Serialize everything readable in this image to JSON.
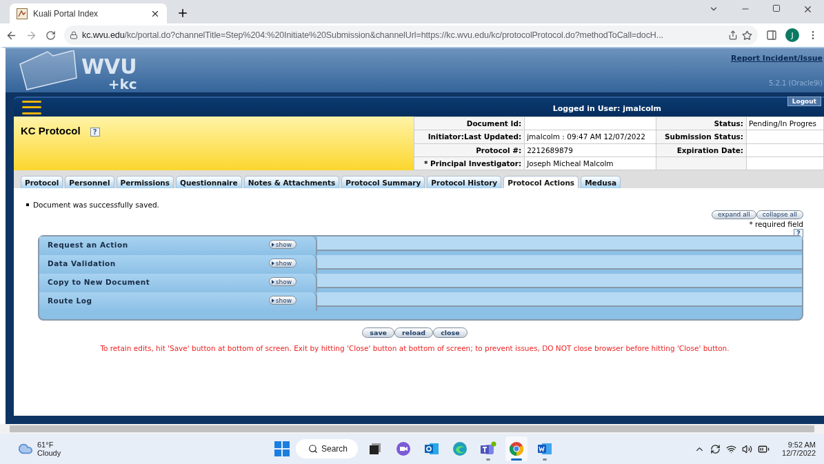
{
  "browser": {
    "tab_title": "Kuali Portal Index",
    "url_host": "kc.wvu.edu",
    "url_path": "/kc/portal.do?channelTitle=Step%204:%20Initiate%20Submission&channelUrl=https://kc.wvu.edu/kc/protocolProtocol.do?methodToCall=docH...",
    "avatar_letter": "J"
  },
  "header": {
    "logo_main": "WVU",
    "logo_sub": "+kc",
    "report_link": "Report Incident/Issue",
    "version": "5.2.1 (Oracle9i)"
  },
  "nav": {
    "logged_in": "Logged in User: jmalcolm",
    "logout": "Logout"
  },
  "document": {
    "title": "KC Protocol",
    "help": "?",
    "info": [
      {
        "label": "Document Id:",
        "label2": "Status:",
        "value2": "Pending/In Progres"
      },
      {
        "label": "Initiator:Last Updated:",
        "value": "jmalcolm : 09:47 AM 12/07/2022",
        "label2": "Submission Status:"
      },
      {
        "label": "Protocol #:",
        "value": "2212689879",
        "label2": "Expiration Date:"
      },
      {
        "label": "* Principal Investigator:",
        "value": "Joseph Micheal Malcolm"
      }
    ]
  },
  "tabs": [
    {
      "label": "Protocol",
      "selected": false
    },
    {
      "label": "Personnel",
      "selected": false
    },
    {
      "label": "Permissions",
      "selected": false
    },
    {
      "label": "Questionnaire",
      "selected": false
    },
    {
      "label": "Notes & Attachments",
      "selected": false
    },
    {
      "label": "Protocol Summary",
      "selected": false
    },
    {
      "label": "Protocol History",
      "selected": false
    },
    {
      "label": "Protocol Actions",
      "selected": true
    },
    {
      "label": "Medusa",
      "selected": false
    }
  ],
  "messages": [
    "Document was successfully saved."
  ],
  "expand_all": "expand all",
  "collapse_all": "collapse all",
  "required_note": "* required field",
  "required_help": "?",
  "sections": [
    {
      "title": "Request an Action",
      "toggle": "show"
    },
    {
      "title": "Data Validation",
      "toggle": "show"
    },
    {
      "title": "Copy to New Document",
      "toggle": "show"
    },
    {
      "title": "Route Log",
      "toggle": "show"
    }
  ],
  "action_buttons": [
    "save",
    "reload",
    "close"
  ],
  "warning": "To retain edits, hit 'Save' button at bottom of screen. Exit by hitting 'Close' button at bottom of screen; to prevent issues, DO NOT close browser before hitting 'Close' button.",
  "taskbar": {
    "temperature": "61°F",
    "condition": "Cloudy",
    "search": "Search",
    "apps": [
      {
        "kind": "files",
        "running": false,
        "selected": false
      },
      {
        "kind": "chat",
        "running": false,
        "selected": false
      },
      {
        "kind": "outlook",
        "running": false,
        "selected": false
      },
      {
        "kind": "edge",
        "running": false,
        "selected": false
      },
      {
        "kind": "teams",
        "running": true,
        "selected": false
      },
      {
        "kind": "chrome",
        "running": true,
        "selected": true
      },
      {
        "kind": "word",
        "running": true,
        "selected": false
      }
    ],
    "time": "9:52 AM",
    "date": "12/7/2022"
  }
}
